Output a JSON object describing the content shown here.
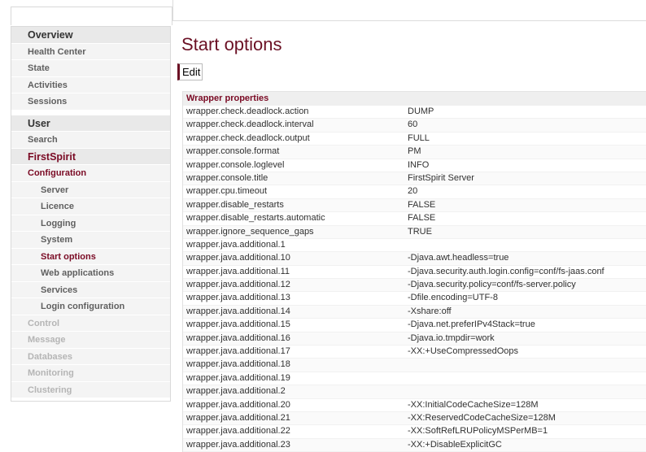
{
  "nav": {
    "items": [
      {
        "label": "Overview",
        "kind": "section"
      },
      {
        "label": "Health Center",
        "kind": "item"
      },
      {
        "label": "State",
        "kind": "item"
      },
      {
        "label": "Activities",
        "kind": "item"
      },
      {
        "label": "Sessions",
        "kind": "item"
      },
      {
        "label": "User",
        "kind": "section"
      },
      {
        "label": "Search",
        "kind": "item"
      },
      {
        "label": "FirstSpirit",
        "kind": "brand"
      },
      {
        "label": "Configuration",
        "kind": "conf"
      },
      {
        "label": "Server",
        "kind": "sub"
      },
      {
        "label": "Licence",
        "kind": "sub"
      },
      {
        "label": "Logging",
        "kind": "sub"
      },
      {
        "label": "System",
        "kind": "sub"
      },
      {
        "label": "Start options",
        "kind": "sub-active"
      },
      {
        "label": "Web applications",
        "kind": "sub"
      },
      {
        "label": "Services",
        "kind": "sub"
      },
      {
        "label": "Login configuration",
        "kind": "sub"
      },
      {
        "label": "Control",
        "kind": "disabled"
      },
      {
        "label": "Message",
        "kind": "disabled"
      },
      {
        "label": "Databases",
        "kind": "disabled"
      },
      {
        "label": "Monitoring",
        "kind": "disabled"
      },
      {
        "label": "Clustering",
        "kind": "disabled"
      }
    ]
  },
  "main": {
    "title": "Start options",
    "edit_label": "Edit",
    "table_header": "Wrapper properties",
    "rows": [
      [
        "wrapper.check.deadlock.action",
        "DUMP"
      ],
      [
        "wrapper.check.deadlock.interval",
        "60"
      ],
      [
        "wrapper.check.deadlock.output",
        "FULL"
      ],
      [
        "wrapper.console.format",
        "PM"
      ],
      [
        "wrapper.console.loglevel",
        "INFO"
      ],
      [
        "wrapper.console.title",
        "FirstSpirit Server"
      ],
      [
        "wrapper.cpu.timeout",
        "20"
      ],
      [
        "wrapper.disable_restarts",
        "FALSE"
      ],
      [
        "wrapper.disable_restarts.automatic",
        "FALSE"
      ],
      [
        "wrapper.ignore_sequence_gaps",
        "TRUE"
      ],
      [
        "wrapper.java.additional.1",
        ""
      ],
      [
        "wrapper.java.additional.10",
        "-Djava.awt.headless=true"
      ],
      [
        "wrapper.java.additional.11",
        "-Djava.security.auth.login.config=conf/fs-jaas.conf"
      ],
      [
        "wrapper.java.additional.12",
        "-Djava.security.policy=conf/fs-server.policy"
      ],
      [
        "wrapper.java.additional.13",
        "-Dfile.encoding=UTF-8"
      ],
      [
        "wrapper.java.additional.14",
        "-Xshare:off"
      ],
      [
        "wrapper.java.additional.15",
        "-Djava.net.preferIPv4Stack=true"
      ],
      [
        "wrapper.java.additional.16",
        "-Djava.io.tmpdir=work"
      ],
      [
        "wrapper.java.additional.17",
        "-XX:+UseCompressedOops"
      ],
      [
        "wrapper.java.additional.18",
        ""
      ],
      [
        "wrapper.java.additional.19",
        ""
      ],
      [
        "wrapper.java.additional.2",
        ""
      ],
      [
        "wrapper.java.additional.20",
        "-XX:InitialCodeCacheSize=128M"
      ],
      [
        "wrapper.java.additional.21",
        "-XX:ReservedCodeCacheSize=128M"
      ],
      [
        "wrapper.java.additional.22",
        "-XX:SoftRefLRUPolicyMSPerMB=1"
      ],
      [
        "wrapper.java.additional.23",
        "-XX:+DisableExplicitGC"
      ]
    ]
  },
  "colors": {
    "accent": "#6b1024",
    "nav_bg": "#f4f4f4",
    "section_bg": "#e9e9e9",
    "disabled_text": "#b5b5b5"
  }
}
